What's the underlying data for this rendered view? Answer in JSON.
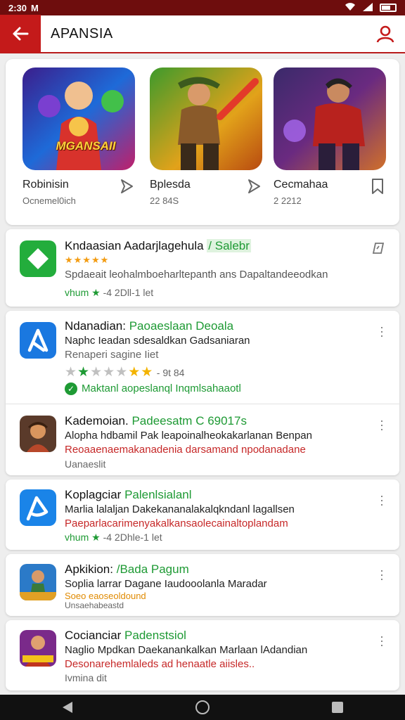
{
  "status": {
    "time": "2:30",
    "extra": "M"
  },
  "header": {
    "title": "APANSIA"
  },
  "featured": [
    {
      "name": "Robinisin",
      "size": "Ocnemel0ich",
      "banner": "MGANSAII"
    },
    {
      "name": "Bplesda",
      "size": "22 84S"
    },
    {
      "name": "Cecmahaa",
      "size": "2 2212"
    }
  ],
  "apps": [
    {
      "title": "Kndaasian  Aadarjlagehula",
      "tag": "/ Salebr",
      "stars": "★★★★★",
      "desc": "Spdaeait leohalmboeharltepanth ans Dapaltandeeodkan",
      "meta_prefix": "vhum",
      "meta": "-4  2Dll-1 let"
    },
    {
      "title": "Ndanadian:",
      "tag": "Paoaeslaan Deoala",
      "desc": "Naphc Ieadan sdesaldkan Gadsaniaran",
      "sub": "Renaperi sagine Iiet",
      "rating_note": "-  9t  84",
      "badge": "Maktanl aopeslanql Inqmlsahaaotl"
    },
    {
      "title": "Kademoian.",
      "tag": "Padeesatm C 69017s",
      "desc": "Alopha hdbamil Pak leapoinalheokakarlanan Benpan",
      "red": "Reoaaenaemakanadenia darsamand npodanadane",
      "meta": "Uanaeslit"
    },
    {
      "title": "Koplagciar",
      "tag": "Palenlsialanl",
      "desc": "Marlia lalaljan Dakekananalakalqkndanl lagallsen",
      "red": "Paeparlacarimenyakalkansaolecainaltoplandam",
      "meta_prefix": "vhum",
      "meta": "-4  2Dhle-1 let"
    },
    {
      "title": "Apkikion:",
      "tag": "/Bada Pagum",
      "desc": "Soplia larrar Dagane Iaudooolanla Maradar",
      "orange": "Soeo eaoseoldound",
      "meta": "Unsaehabeastd"
    },
    {
      "title": "Cocianciar",
      "tag": "Padenstsiol",
      "desc": "Naglio Mpdkan Daekanankalkan Marlaan lAdandian",
      "red": "Desonarehemlaleds ad henaatle aiisles..",
      "meta": "Ivmina dit"
    }
  ],
  "colors": {
    "accent": "#c41a1a",
    "status_bar": "#6e0d0d",
    "green": "#1e9a34",
    "red_text": "#c62828"
  }
}
